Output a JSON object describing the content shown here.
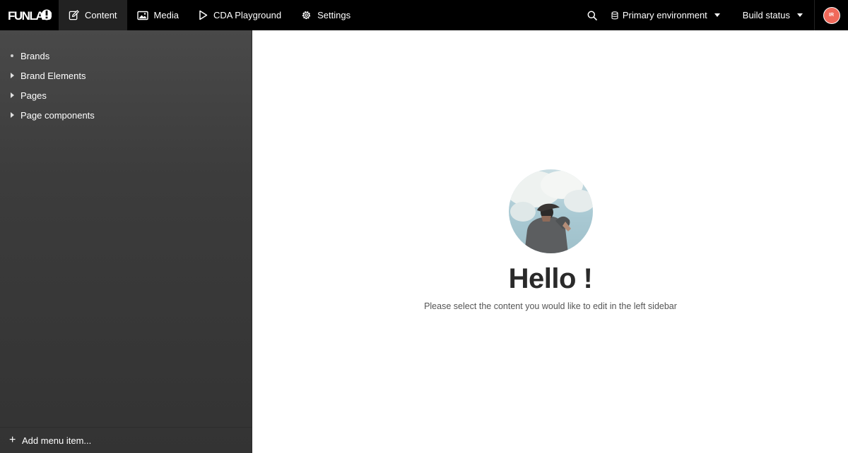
{
  "header": {
    "logo_text": "FUNLAB!",
    "nav": [
      {
        "label": "Content",
        "icon": "edit-icon",
        "active": true
      },
      {
        "label": "Media",
        "icon": "image-icon",
        "active": false
      },
      {
        "label": "CDA Playground",
        "icon": "play-icon",
        "active": false
      },
      {
        "label": "Settings",
        "icon": "gear-icon",
        "active": false
      }
    ],
    "environment_label": "Primary environment",
    "build_status_label": "Build status",
    "avatar_initials": "IR"
  },
  "sidebar": {
    "items": [
      {
        "label": "Brands",
        "marker": "bullet"
      },
      {
        "label": "Brand Elements",
        "marker": "collapsed"
      },
      {
        "label": "Pages",
        "marker": "collapsed"
      },
      {
        "label": "Page components",
        "marker": "collapsed"
      }
    ],
    "add_menu_item_label": "Add menu item..."
  },
  "main": {
    "greeting": "Hello !",
    "instruction": "Please select the content you would like to edit in the left sidebar"
  },
  "colors": {
    "topbar": "#000000",
    "sidebar": "#3c3c3c",
    "avatar": "#f0695a"
  }
}
